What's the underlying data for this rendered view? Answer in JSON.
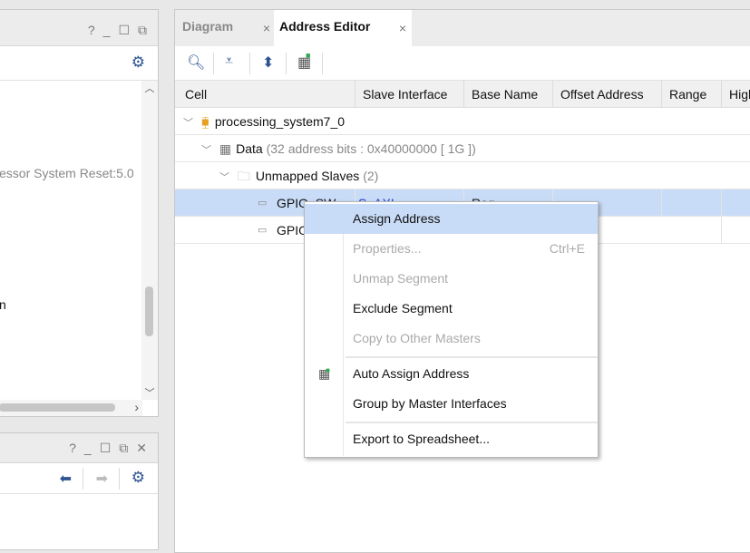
{
  "left_top": {
    "text1": "essor System Reset:5.0",
    "text2": "n"
  },
  "right": {
    "tabs": [
      {
        "label": "Diagram"
      },
      {
        "label": "Address Editor"
      }
    ],
    "columns": [
      "Cell",
      "Slave Interface",
      "Base Name",
      "Offset Address",
      "Range",
      "High"
    ],
    "rows": [
      {
        "name": "processing_system7_0"
      },
      {
        "name": "Data",
        "detail": "(32 address bits : 0x40000000 [ 1G ])"
      },
      {
        "name": "Unmapped Slaves",
        "detail": "(2)"
      },
      {
        "name": "GPIO_SW",
        "slave": "S_AXI",
        "base": "Reg"
      },
      {
        "name": "GPIO"
      }
    ]
  },
  "context_menu": {
    "items": [
      {
        "label": "Assign Address",
        "enabled": true
      },
      {
        "label": "Properties...",
        "shortcut": "Ctrl+E",
        "enabled": false
      },
      {
        "label": "Unmap Segment",
        "enabled": false
      },
      {
        "label": "Exclude Segment",
        "enabled": true
      },
      {
        "label": "Copy to Other Masters",
        "enabled": false
      },
      {
        "label": "Auto Assign Address",
        "enabled": true,
        "icon": "auto-assign-icon"
      },
      {
        "label": "Group by Master Interfaces",
        "enabled": true
      },
      {
        "label": "Export to Spreadsheet...",
        "enabled": true
      }
    ]
  },
  "colors": {
    "accent": "#2d5390",
    "selection": "#c9dcf7"
  }
}
